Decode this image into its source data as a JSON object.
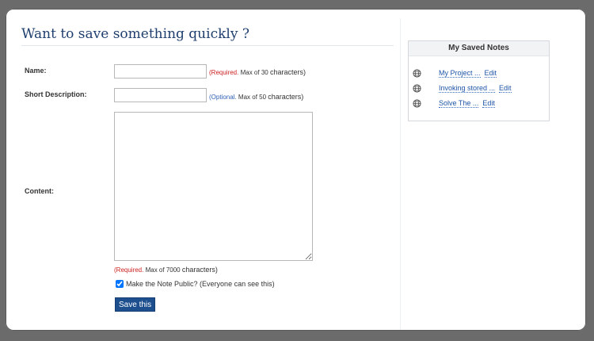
{
  "heading": "Want to save something quickly ?",
  "form": {
    "name_label": "Name:",
    "short_desc_label": "Short Description:",
    "content_label": "Content:",
    "name_value": "",
    "short_desc_value": "",
    "content_value": "",
    "name_hint": {
      "tag": "(Required.",
      "tail": " Max of 30 ",
      "big": "characters)"
    },
    "short_desc_hint": {
      "tag": "(Optional.",
      "tail": " Max of 50 ",
      "big": "characters)"
    },
    "content_hint": {
      "tag": "(Required.",
      "tail": " Max of 7000 ",
      "big": "characters)"
    },
    "public_checkbox_label": "Make the Note Public? (Everyone can see this)",
    "public_checked": true,
    "save_label": "Save this"
  },
  "sidebar": {
    "title": "My Saved Notes",
    "notes": [
      {
        "title": "My Project ...",
        "edit": "Edit",
        "icon": "globe-icon"
      },
      {
        "title": "Invoking stored ...",
        "edit": "Edit",
        "icon": "globe-icon"
      },
      {
        "title": "Solve The ...",
        "edit": "Edit",
        "icon": "globe-icon"
      }
    ]
  },
  "colors": {
    "heading": "#1f3f6e",
    "required": "#cc1f1f",
    "optional": "#2f5fb3",
    "button": "#1d4f8f",
    "link": "#1f56a8"
  }
}
